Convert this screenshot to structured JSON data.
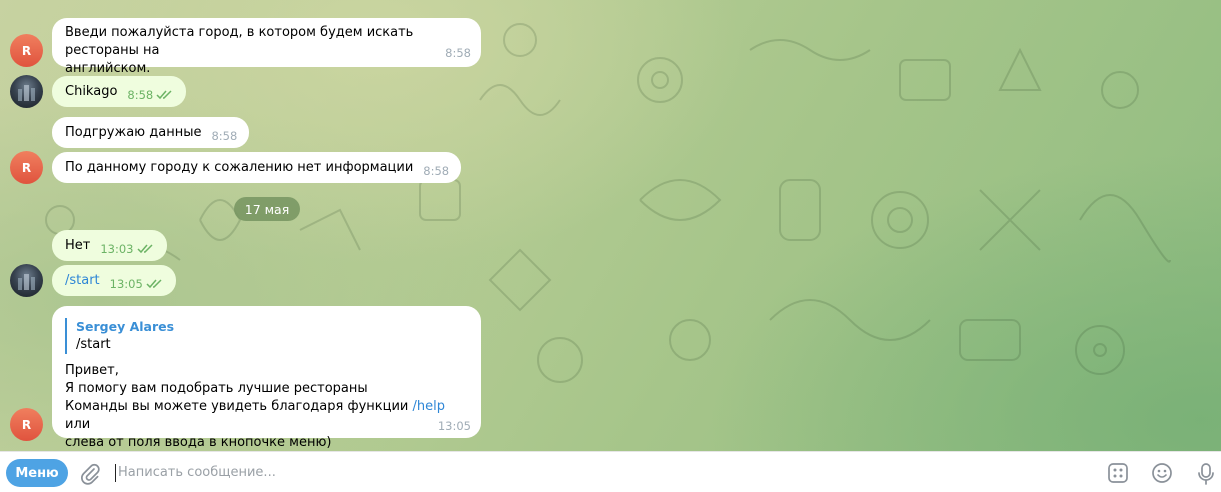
{
  "messages": [
    {
      "id": "m1",
      "lines": [
        "Введи пожалуйста город, в котором будем искать рестораны на",
        "английском."
      ],
      "time": "8:58",
      "sender_initial": "R",
      "outgoing": false
    },
    {
      "id": "m2",
      "text": "Chikago",
      "time": "8:58",
      "outgoing": true,
      "read": true
    },
    {
      "id": "m3",
      "text": "Подгружаю данные",
      "time": "8:58",
      "outgoing": false
    },
    {
      "id": "m4",
      "text": "По данному городу к сожалению нет информации",
      "time": "8:58",
      "sender_initial": "R",
      "outgoing": false
    },
    {
      "id": "m5",
      "text": "Нет",
      "time": "13:03",
      "outgoing": true,
      "read": true
    },
    {
      "id": "m6",
      "text": "/start",
      "time": "13:05",
      "outgoing": true,
      "read": true
    },
    {
      "id": "m7",
      "reply_author": "Sergey Alares",
      "reply_text": "/start",
      "lines": [
        "Привет,",
        "Я помогу вам подобрать лучшие рестораны"
      ],
      "line3_before": "Команды вы можете увидеть благодаря функции ",
      "line3_link": "/help",
      "line3_after": " или",
      "line4": "слева от поля ввода в кнопочке меню)",
      "time": "13:05",
      "sender_initial": "R",
      "outgoing": false
    }
  ],
  "date_separator": "17 мая",
  "input": {
    "menu_label": "Меню",
    "placeholder": "Написать сообщение..."
  },
  "icons": {
    "attach": "paperclip-icon",
    "commands": "bot-commands-icon",
    "emoji": "emoji-icon",
    "voice": "microphone-icon"
  },
  "colors": {
    "incoming_bubble": "#ffffff",
    "outgoing_bubble": "#effdde",
    "read_check": "#6cb365",
    "link": "#2e86d6",
    "menu_button": "#4ea3e4",
    "bot_avatar": "#e0533e"
  }
}
